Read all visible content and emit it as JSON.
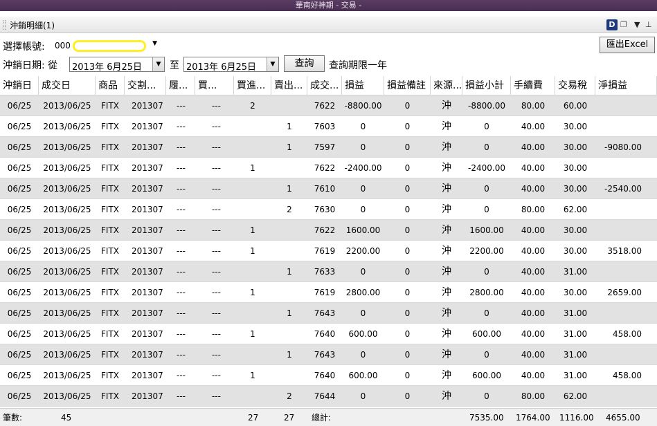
{
  "window_title": "華南好神期 - 交易 -",
  "panel_title": "沖銷明細(1)",
  "account": {
    "label": "選擇帳號:",
    "value_prefix": "000"
  },
  "date_range": {
    "label": "沖銷日期: 從",
    "from": "2013年  6月25日",
    "to_label": "至",
    "to": "2013年  6月25日",
    "query_button": "查詢",
    "note": "查詢期限一年"
  },
  "export_button": "匯出Excel",
  "columns": [
    "沖銷日",
    "成交日",
    "商品",
    "交割...",
    "履...",
    "買...",
    "買進...",
    "賣出...",
    "成交...",
    "損益",
    "損益備註",
    "來源...",
    "損益小計",
    "手續費",
    "交易稅",
    "淨損益"
  ],
  "rows": [
    [
      "06/25",
      "2013/06/25",
      "FITX",
      "201307",
      "---",
      "---",
      "2",
      "",
      "7622",
      "-8800.00",
      "0",
      "沖",
      "-8800.00",
      "80.00",
      "60.00",
      ""
    ],
    [
      "06/25",
      "2013/06/25",
      "FITX",
      "201307",
      "---",
      "---",
      "",
      "1",
      "7603",
      "0",
      "0",
      "沖",
      "0",
      "40.00",
      "30.00",
      ""
    ],
    [
      "06/25",
      "2013/06/25",
      "FITX",
      "201307",
      "---",
      "---",
      "",
      "1",
      "7597",
      "0",
      "0",
      "沖",
      "0",
      "40.00",
      "30.00",
      "-9080.00"
    ],
    [
      "06/25",
      "2013/06/25",
      "FITX",
      "201307",
      "---",
      "---",
      "1",
      "",
      "7622",
      "-2400.00",
      "0",
      "沖",
      "-2400.00",
      "40.00",
      "30.00",
      ""
    ],
    [
      "06/25",
      "2013/06/25",
      "FITX",
      "201307",
      "---",
      "---",
      "",
      "1",
      "7610",
      "0",
      "0",
      "沖",
      "0",
      "40.00",
      "30.00",
      "-2540.00"
    ],
    [
      "06/25",
      "2013/06/25",
      "FITX",
      "201307",
      "---",
      "---",
      "",
      "2",
      "7630",
      "0",
      "0",
      "沖",
      "0",
      "80.00",
      "62.00",
      ""
    ],
    [
      "06/25",
      "2013/06/25",
      "FITX",
      "201307",
      "---",
      "---",
      "1",
      "",
      "7622",
      "1600.00",
      "0",
      "沖",
      "1600.00",
      "40.00",
      "30.00",
      ""
    ],
    [
      "06/25",
      "2013/06/25",
      "FITX",
      "201307",
      "---",
      "---",
      "1",
      "",
      "7619",
      "2200.00",
      "0",
      "沖",
      "2200.00",
      "40.00",
      "30.00",
      "3518.00"
    ],
    [
      "06/25",
      "2013/06/25",
      "FITX",
      "201307",
      "---",
      "---",
      "",
      "1",
      "7633",
      "0",
      "0",
      "沖",
      "0",
      "40.00",
      "31.00",
      ""
    ],
    [
      "06/25",
      "2013/06/25",
      "FITX",
      "201307",
      "---",
      "---",
      "1",
      "",
      "7619",
      "2800.00",
      "0",
      "沖",
      "2800.00",
      "40.00",
      "30.00",
      "2659.00"
    ],
    [
      "06/25",
      "2013/06/25",
      "FITX",
      "201307",
      "---",
      "---",
      "",
      "1",
      "7643",
      "0",
      "0",
      "沖",
      "0",
      "40.00",
      "31.00",
      ""
    ],
    [
      "06/25",
      "2013/06/25",
      "FITX",
      "201307",
      "---",
      "---",
      "1",
      "",
      "7640",
      "600.00",
      "0",
      "沖",
      "600.00",
      "40.00",
      "31.00",
      "458.00"
    ],
    [
      "06/25",
      "2013/06/25",
      "FITX",
      "201307",
      "---",
      "---",
      "",
      "1",
      "7643",
      "0",
      "0",
      "沖",
      "0",
      "40.00",
      "31.00",
      ""
    ],
    [
      "06/25",
      "2013/06/25",
      "FITX",
      "201307",
      "---",
      "---",
      "1",
      "",
      "7640",
      "600.00",
      "0",
      "沖",
      "600.00",
      "40.00",
      "31.00",
      "458.00"
    ],
    [
      "06/25",
      "2013/06/25",
      "FITX",
      "201307",
      "---",
      "---",
      "",
      "2",
      "7644",
      "0",
      "0",
      "沖",
      "0",
      "80.00",
      "62.00",
      ""
    ]
  ],
  "footer": {
    "count_label": "筆數:",
    "count": "45",
    "buy_total": "27",
    "sell_total": "27",
    "total_label": "總計:",
    "pl_total": "7535.00",
    "fee_total": "1764.00",
    "tax_total": "1116.00",
    "net_total": "4655.00"
  }
}
